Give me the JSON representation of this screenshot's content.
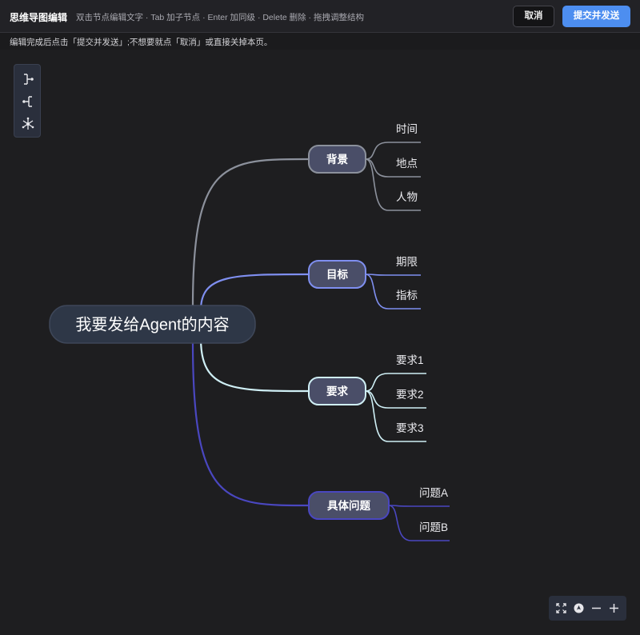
{
  "header": {
    "title": "思维导图编辑",
    "hint": "双击节点编辑文字 · Tab 加子节点 · Enter 加同级 · Delete 删除 · 拖拽调整结构",
    "cancel_label": "取消",
    "submit_label": "提交并发送"
  },
  "subbar": {
    "text": "编辑完成后点击「提交并发送」;不想要就点「取消」或直接关掉本页。"
  },
  "mindmap": {
    "root": "我要发给Agent的内容",
    "branches": [
      {
        "label": "背景",
        "color": "#8c919c",
        "children": [
          "时间",
          "地点",
          "人物"
        ]
      },
      {
        "label": "目标",
        "color": "#7f8ff0",
        "children": [
          "期限",
          "指标"
        ]
      },
      {
        "label": "要求",
        "color": "#cfeff5",
        "children": [
          "要求1",
          "要求2",
          "要求3"
        ]
      },
      {
        "label": "具体问题",
        "color": "#4a47c0",
        "children": [
          "问题A",
          "问题B"
        ]
      }
    ]
  },
  "toolbar": {
    "icons": [
      "layout-right-icon",
      "layout-left-icon",
      "layout-radial-icon"
    ]
  },
  "zoom": {
    "icons": [
      "fit-screen-icon",
      "locate-icon",
      "zoom-out-icon",
      "zoom-in-icon"
    ]
  }
}
